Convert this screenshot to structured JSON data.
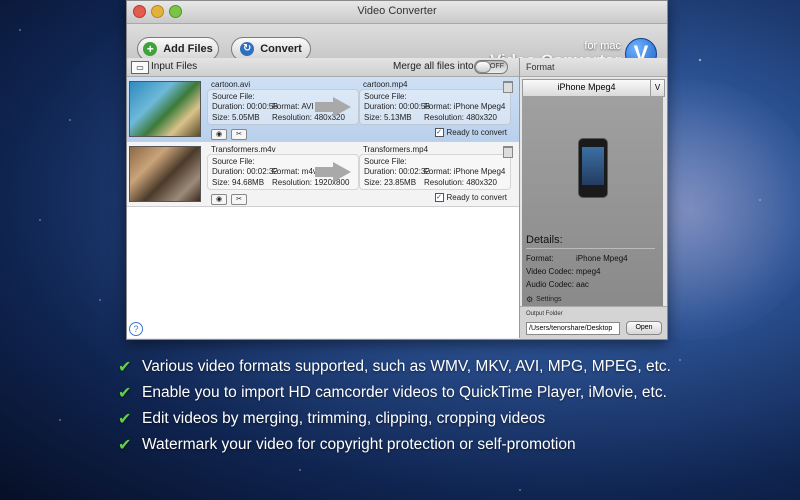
{
  "window": {
    "title": "Video Converter"
  },
  "toolbar": {
    "add_files": "Add Files",
    "convert": "Convert"
  },
  "logo": {
    "small": "for mac",
    "big": "Video Converter",
    "mark": "V"
  },
  "list": {
    "input_files_label": "Input Files",
    "merge_label": "Merge all files into one:",
    "merge_toggle": "OFF",
    "items": [
      {
        "src_name": "cartoon.avi",
        "src_label": "Source File:",
        "src_duration": "Duration: 00:00:58",
        "src_format": "Format: AVI",
        "src_size": "Size: 5.05MB",
        "src_resolution": "Resolution: 480x320",
        "dst_name": "cartoon.mp4",
        "dst_label": "Source File:",
        "dst_duration": "Duration: 00:00:58",
        "dst_format": "Format: iPhone Mpeg4",
        "dst_size": "Size: 5.13MB",
        "dst_resolution": "Resolution: 480x320",
        "ready": "Ready to convert"
      },
      {
        "src_name": "Transformers.m4v",
        "src_label": "Source File:",
        "src_duration": "Duration: 00:02:32",
        "src_format": "Format: m4v",
        "src_size": "Size: 94.68MB",
        "src_resolution": "Resolution: 1920x800",
        "dst_name": "Transformers.mp4",
        "dst_label": "Source File:",
        "dst_duration": "Duration: 00:02:32",
        "dst_format": "Format: iPhone Mpeg4",
        "dst_size": "Size: 23.85MB",
        "dst_resolution": "Resolution: 480x320",
        "ready": "Ready to convert"
      }
    ]
  },
  "format_panel": {
    "header": "Format",
    "selected": "iPhone Mpeg4",
    "dropdown_glyph": "V",
    "details_title": "Details:",
    "format_label": "Format:",
    "format_value": "iPhone Mpeg4",
    "video_codec_label": "Video Codec:",
    "video_codec_value": "mpeg4",
    "audio_codec_label": "Audio Codec:",
    "audio_codec_value": "aac",
    "settings": "Settings",
    "output_folder_label": "Output Folder",
    "output_path": "/Users/tenorshare/Desktop",
    "open": "Open"
  },
  "features": [
    "Various video formats supported, such as WMV, MKV, AVI, MPG, MPEG, etc.",
    "Enable you to import HD camcorder videos to QuickTime Player, iMovie, etc.",
    "Edit videos by merging, trimming, clipping, cropping videos",
    "Watermark your video for copyright protection or self-promotion"
  ],
  "colors": {
    "check": "#5fd33f",
    "accent_blue": "#2f6fbf",
    "selection": "#b9d0ec"
  },
  "icons": [
    "close-icon",
    "minimize-icon",
    "maximize-icon",
    "add-icon",
    "convert-icon",
    "trash-icon",
    "eye-icon",
    "trim-icon",
    "check-icon",
    "gear-icon",
    "help-icon"
  ]
}
